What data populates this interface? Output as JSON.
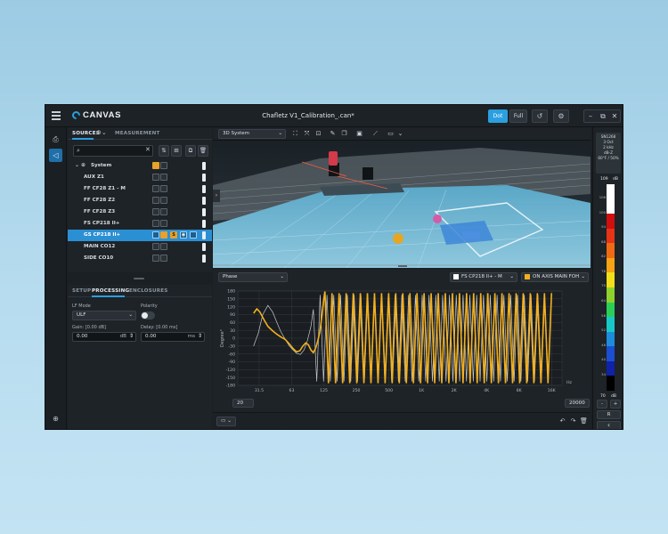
{
  "app": {
    "logo_text": "CANVAS",
    "document_title": "Chafletz V1_Calibration_.can*",
    "dot_label": "Dot",
    "full_label": "Full"
  },
  "sources_panel": {
    "tabs": [
      {
        "label": "SOURCES",
        "active": true
      },
      {
        "label": "MEASUREMENT",
        "active": false
      }
    ],
    "search": {
      "value": "",
      "placeholder": ""
    },
    "tree": [
      {
        "label": "System",
        "group": true,
        "selected": false
      },
      {
        "label": "AUX Z1",
        "selected": false
      },
      {
        "label": "FF CF28 Z1 - M",
        "selected": false
      },
      {
        "label": "FF CF28 Z2",
        "selected": false
      },
      {
        "label": "FF CF28 Z3",
        "selected": false
      },
      {
        "label": "FS CP218 II+",
        "selected": false
      },
      {
        "label": "GS CP218 II+",
        "selected": true
      },
      {
        "label": "MAIN CO12",
        "selected": false
      },
      {
        "label": "SIDE CO10",
        "selected": false
      }
    ]
  },
  "processing_panel": {
    "tabs": [
      {
        "label": "SETUP",
        "active": false
      },
      {
        "label": "PROCESSING",
        "active": true
      },
      {
        "label": "ENCLOSURES",
        "active": false
      }
    ],
    "lf_mode_label": "LF Mode",
    "lf_mode_value": "ULF",
    "polarity_label": "Polarity",
    "gain_label": "Gain: [0.00 dB]",
    "gain_value": "0.00",
    "gain_unit": "dB",
    "delay_label": "Delay: [0.00 ms]",
    "delay_value": "0.00",
    "delay_unit": "ms"
  },
  "view3d": {
    "mode_select": "3D System"
  },
  "phase_chart": {
    "type_select": "Phase",
    "source_select": "FS CP218 II+ - M",
    "measurement_select": "ON AXIS MAIN FOH",
    "source_color": "#ffffff",
    "measurement_color": "#f2b01e",
    "min_freq": "20",
    "max_freq": "20000",
    "freq_unit": "Hz"
  },
  "chart_data": {
    "type": "line",
    "title": "",
    "xlabel": "",
    "ylabel": "Degree°",
    "x_scale": "log",
    "xlim": [
      20,
      20000
    ],
    "ylim": [
      -180,
      180
    ],
    "x_ticks": [
      "31.5",
      "63",
      "125",
      "250",
      "500",
      "1K",
      "2K",
      "4K",
      "8K",
      "16K"
    ],
    "x_tick_values": [
      31.5,
      63,
      125,
      250,
      500,
      1000,
      2000,
      4000,
      8000,
      16000
    ],
    "y_ticks": [
      "180",
      "150",
      "120",
      "90",
      "60",
      "30",
      "0",
      "-30",
      "-60",
      "-90",
      "-120",
      "-150",
      "-180"
    ],
    "grid": true,
    "series": [
      {
        "name": "ON AXIS MAIN FOH",
        "color": "#f2b01e",
        "x": [
          28,
          30,
          32,
          35,
          38,
          42,
          46,
          50,
          55,
          60,
          65,
          70,
          75,
          80,
          85,
          90,
          95,
          100,
          105,
          110,
          115,
          120,
          125,
          128
        ],
        "y": [
          95,
          112,
          100,
          70,
          45,
          28,
          15,
          5,
          -5,
          -22,
          -40,
          -52,
          -48,
          -30,
          -18,
          -25,
          -45,
          -55,
          -38,
          -10,
          25,
          85,
          150,
          178
        ]
      },
      {
        "name": "FS CP218 II+ - M",
        "color": "#e6e6e6",
        "x": [
          28,
          31,
          34,
          38,
          42,
          46,
          50,
          55,
          60,
          65,
          70,
          76,
          82,
          88,
          95,
          100
        ],
        "y": [
          -30,
          20,
          90,
          125,
          100,
          60,
          25,
          -5,
          -30,
          -45,
          -58,
          -62,
          -45,
          -10,
          45,
          110
        ]
      }
    ]
  },
  "meter": {
    "info_lines": [
      "SN1268",
      "3 Oct",
      "2 kHz",
      "dB-Z",
      "60°F / 50%"
    ],
    "top_value": "109",
    "top_unit": "dB",
    "scale": [
      "106",
      "100",
      "94",
      "88",
      "82",
      "76",
      "70",
      "64",
      "58",
      "52",
      "46",
      "40",
      "34"
    ],
    "bottom_value": "70",
    "bottom_unit": "dB",
    "minus_label": "-",
    "plus_label": "+",
    "r_label": "R",
    "colors": [
      "#ffffff",
      "#ffffff",
      "#d10f0f",
      "#e63417",
      "#f06a14",
      "#f7a313",
      "#f2df1a",
      "#8ed22e",
      "#2bcf58",
      "#18c8c8",
      "#1d8cdb",
      "#1a4fd1",
      "#1022a8",
      "#000000"
    ]
  }
}
